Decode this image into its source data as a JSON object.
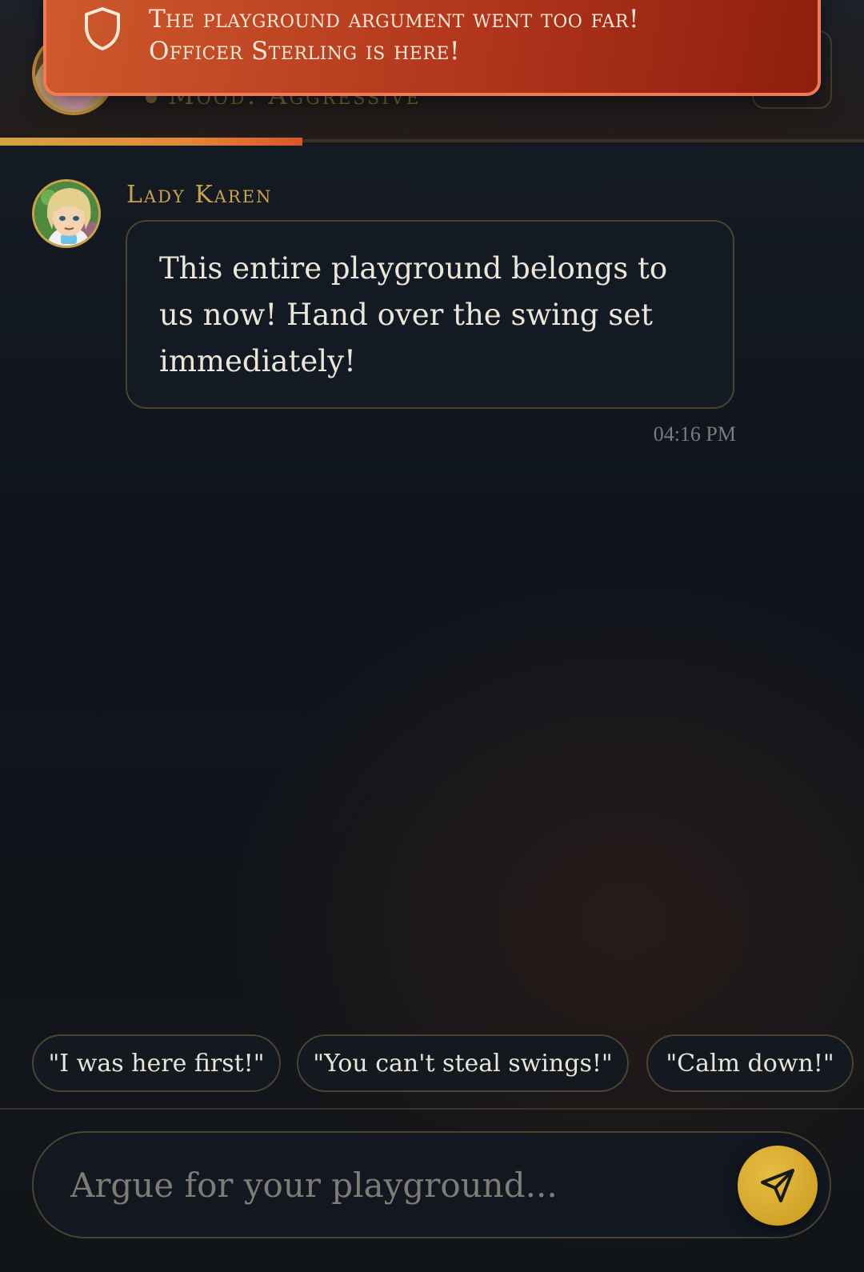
{
  "header": {
    "mood_text": "Mood: Aggressive",
    "progress": 0.35
  },
  "toast": {
    "icon": "shield-icon",
    "line1": "The playground argument went too far!",
    "line2": "Officer Sterling is here!"
  },
  "message": {
    "author": "Lady Karen",
    "text": "This entire playground belongs to us now! Hand over the swing set immediately!",
    "timestamp": "04:16 PM"
  },
  "quick_replies": [
    "\"I was here first!\"",
    "\"You can't steal swings!\"",
    "\"Calm down!\""
  ],
  "composer": {
    "placeholder": "Argue for your playground...",
    "send_icon": "send-icon"
  },
  "colors": {
    "accent_gold": "#c9a24a",
    "toast_red": "#b1361c",
    "background": "#10151d"
  }
}
